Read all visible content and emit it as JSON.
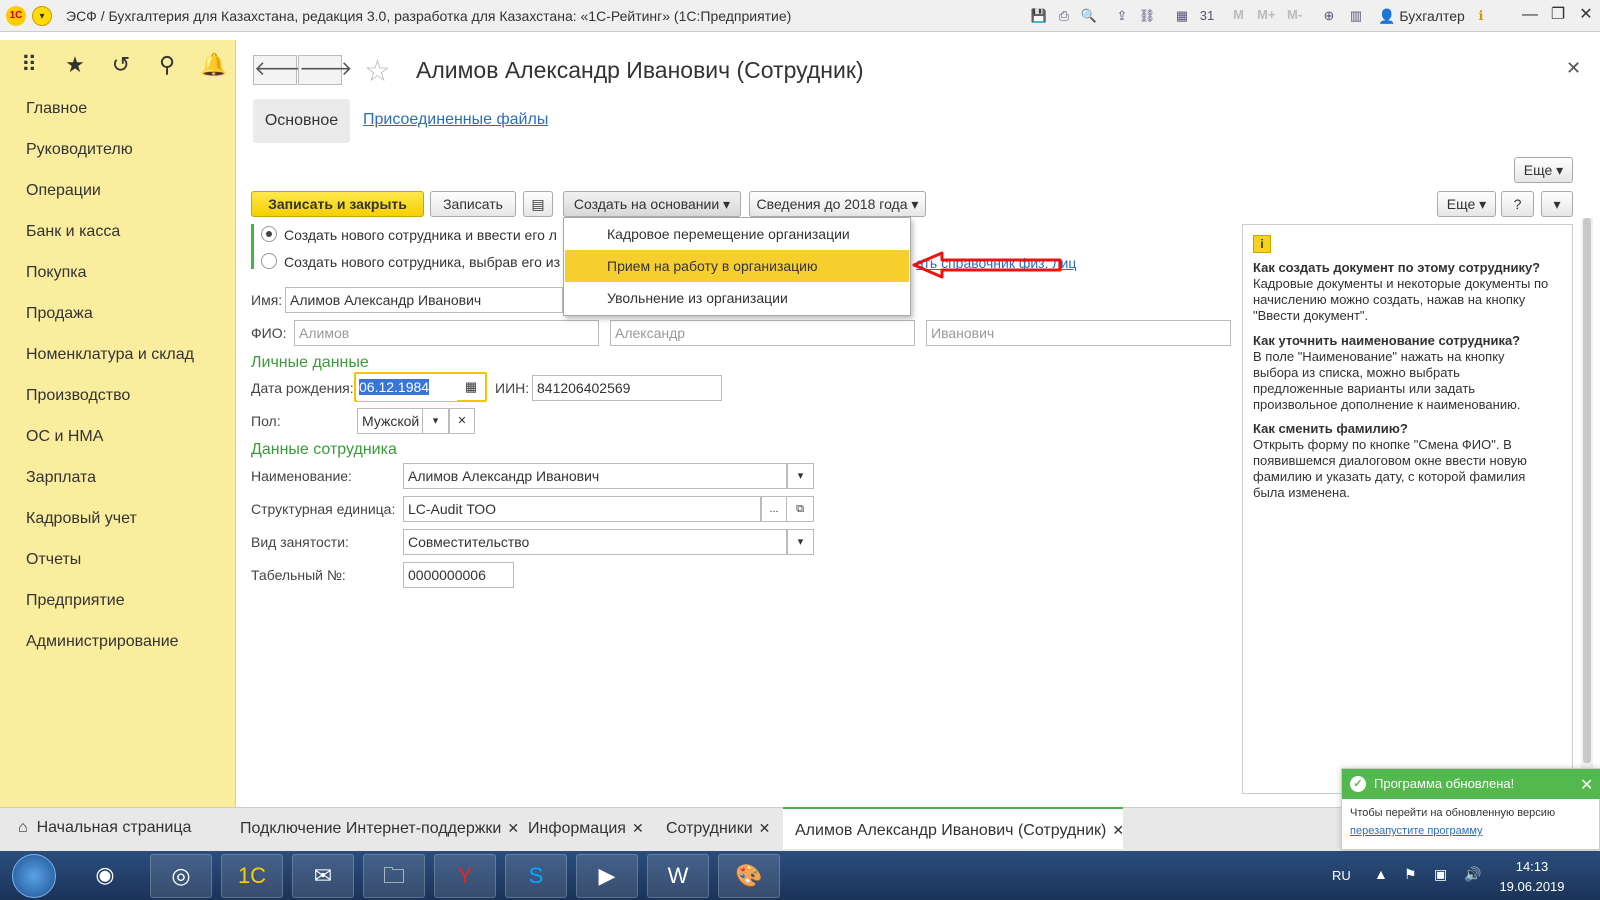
{
  "window": {
    "title": "ЭСФ / Бухгалтерия для Казахстана, редакция 3.0, разработка для Казахстана: «1С-Рейтинг» (1С:Предприятие)",
    "logo_text": "1С",
    "user": "Бухгалтер",
    "m_buttons": [
      "M",
      "M+",
      "M-"
    ]
  },
  "sidebar": {
    "items": [
      "Главное",
      "Руководителю",
      "Операции",
      "Банк и касса",
      "Покупка",
      "Продажа",
      "Номенклатура и склад",
      "Производство",
      "ОС и НМА",
      "Зарплата",
      "Кадровый учет",
      "Отчеты",
      "Предприятие",
      "Администрирование"
    ]
  },
  "document": {
    "title": "Алимов Александр Иванович (Сотрудник)",
    "tabs": {
      "main": "Основное",
      "files": "Присоединенные файлы"
    }
  },
  "toolbar": {
    "save_close": "Записать и закрыть",
    "save": "Записать",
    "create_based": "Создать на основании",
    "info_2018": "Сведения до 2018 года",
    "more": "Еще",
    "help": "?"
  },
  "dropdown": {
    "items": [
      "Кадровое перемещение организации",
      "Прием на работу в организацию",
      "Увольнение из организации"
    ],
    "highlighted_index": 1
  },
  "radios": {
    "opt1": "Создать нового сотрудника и ввести его л",
    "opt2": "Создать нового сотрудника, выбрав его из",
    "link_tail": "ать справочник физ. лиц"
  },
  "form": {
    "name_label": "Имя:",
    "name_value": "Алимов Александр Иванович",
    "fio_label": "ФИО:",
    "fio_last": "Алимов",
    "fio_first": "Александр",
    "fio_middle": "Иванович",
    "personal_section": "Личные данные",
    "birth_label": "Дата рождения:",
    "birth_value": "06.12.1984",
    "iin_label": "ИИН:",
    "iin_value": "841206402569",
    "gender_label": "Пол:",
    "gender_value": "Мужской",
    "employee_section": "Данные сотрудника",
    "naming_label": "Наименование:",
    "naming_value": "Алимов Александр Иванович",
    "unit_label": "Структурная единица:",
    "unit_value": "LC-Audit ТОО",
    "employment_label": "Вид занятости:",
    "employment_value": "Совместительство",
    "tabnum_label": "Табельный №:",
    "tabnum_value": "0000000006"
  },
  "help": {
    "q1": "Как создать документ по этому сотруднику?",
    "a1": "Кадровые документы и некоторые документы по начислению можно создать, нажав на кнопку \"Ввести документ\".",
    "q2": "Как уточнить наименование сотрудника?",
    "a2": "В поле \"Наименование\" нажать на кнопку выбора из списка, можно выбрать предложенные варианты или задать произвольное дополнение к наименованию.",
    "q3": "Как сменить фамилию?",
    "a3": "Открыть форму по кнопке \"Смена ФИО\". В появившемся диалоговом окне ввести новую фамилию и указать дату, с которой фамилия была изменена."
  },
  "bottom_tabs": {
    "home": "Начальная страница",
    "tabs": [
      "Подключение Интернет-поддержки",
      "Информация",
      "Сотрудники",
      "Алимов Александр Иванович (Сотрудник)"
    ]
  },
  "notification": {
    "title": "Программа обновлена!",
    "text": "Чтобы перейти на обновленную версию",
    "link": "перезапустите программу"
  },
  "taskbar": {
    "lang": "RU",
    "time": "14:13",
    "date": "19.06.2019"
  },
  "colors": {
    "sidebar_bg": "#fbed9e",
    "accent_yellow": "#f6cf2f",
    "section_green": "#3a9b3a",
    "link_blue": "#2a6ebb",
    "notification_green": "#53b84d"
  }
}
